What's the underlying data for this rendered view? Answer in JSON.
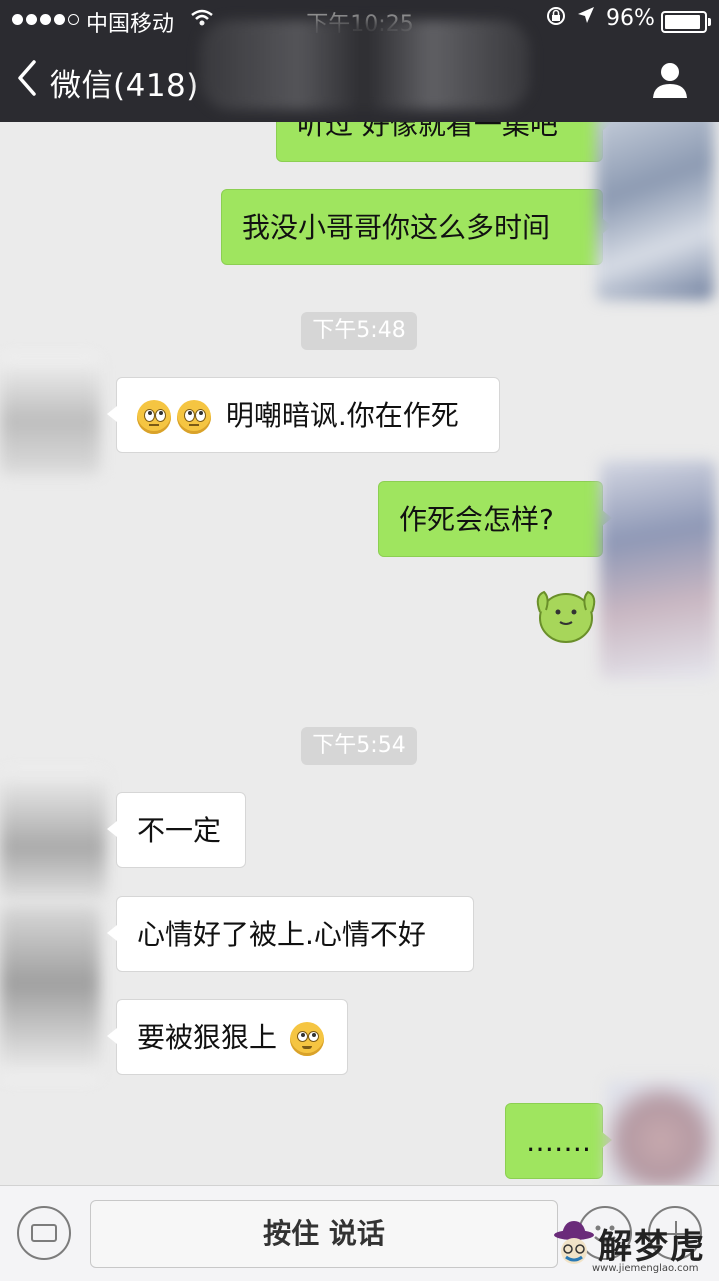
{
  "status_bar": {
    "carrier": "中国移动",
    "time": "下午10:25",
    "battery_percent": "96%",
    "battery_level": 0.96
  },
  "nav": {
    "back_label": "微信(418)"
  },
  "messages": {
    "m0": "听过 好像就看一集吧",
    "m1": "我没小哥哥你这么多时间",
    "ts1": "下午5:48",
    "m2": "明嘲暗讽.你在作死",
    "m3": "作死会怎样?",
    "ts2": "下午5:54",
    "m4": "不一定",
    "m5": "心情好了被上.心情不好",
    "m6": "要被狠狠上",
    "m7": "……."
  },
  "input_bar": {
    "hold_to_talk": "按住 说话"
  },
  "watermark": {
    "name": "解梦虎",
    "url": "www.jiemenglao.com"
  },
  "colors": {
    "nav_bg": "#2b2b30",
    "chat_bg": "#ebebeb",
    "sent_bubble": "#9fe55f",
    "received_bubble": "#ffffff"
  }
}
